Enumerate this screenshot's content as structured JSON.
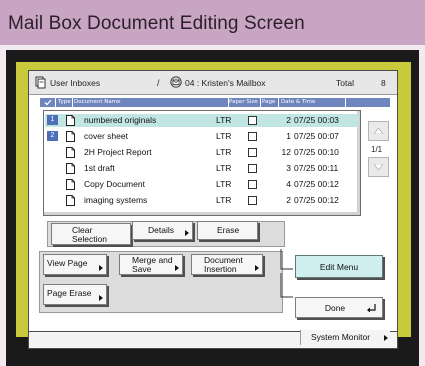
{
  "banner": {
    "title": "Mail Box Document Editing Screen"
  },
  "header": {
    "inbox_label": "User Inboxes",
    "separator": "/",
    "box_name": "04 : Kristen's Mailbox",
    "total_label": "Total",
    "total_value": "8"
  },
  "columns": {
    "type": "Type",
    "name": "Document Name",
    "paper_size": "Paper Size",
    "pages": "Page",
    "date_time": "Date & Time"
  },
  "documents": [
    {
      "number": "1",
      "name": "numbered originals",
      "size": "LTR",
      "pages": "2",
      "datetime": "07/25 00:03",
      "selected": true
    },
    {
      "number": "2",
      "name": "cover sheet",
      "size": "LTR",
      "pages": "1",
      "datetime": "07/25 00:07",
      "selected": false
    },
    {
      "number": "",
      "name": "2H Project Report",
      "size": "LTR",
      "pages": "12",
      "datetime": "07/25 00:10",
      "selected": false
    },
    {
      "number": "",
      "name": "1st draft",
      "size": "LTR",
      "pages": "3",
      "datetime": "07/25 00:11",
      "selected": false
    },
    {
      "number": "",
      "name": "Copy Document",
      "size": "LTR",
      "pages": "4",
      "datetime": "07/25 00:12",
      "selected": false
    },
    {
      "number": "",
      "name": "imaging systems",
      "size": "LTR",
      "pages": "2",
      "datetime": "07/25 00:12",
      "selected": false
    }
  ],
  "page_indicator": "1/1",
  "buttons": {
    "clear_selection": "Clear\nSelection",
    "details": "Details",
    "erase": "Erase",
    "view_page": "View Page",
    "merge_and_save": "Merge and\nSave",
    "document_insertion": "Document\nInsertion",
    "page_erase": "Page Erase",
    "edit_menu": "Edit Menu",
    "done": "Done"
  },
  "system_monitor": "System Monitor",
  "colors": {
    "banner": "#c9a5c4",
    "frame": "#f3e9f1",
    "bezel_dark": "#1a1a1a",
    "bezel_olive": "#c8c93b",
    "column_bar": "#6f85bd",
    "selected_row": "#c1e5e3",
    "number_badge": "#4c6fb8",
    "edit_menu": "#cfeeed"
  }
}
